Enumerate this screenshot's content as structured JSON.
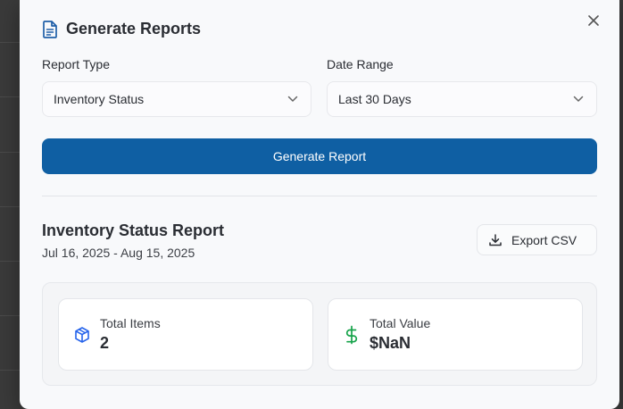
{
  "modal": {
    "title": "Generate Reports",
    "close_icon": "close-icon",
    "title_icon": "document-icon"
  },
  "form": {
    "report_type": {
      "label": "Report Type",
      "value": "Inventory Status"
    },
    "date_range": {
      "label": "Date Range",
      "value": "Last 30 Days"
    },
    "generate_label": "Generate Report"
  },
  "report": {
    "title": "Inventory Status Report",
    "date_range": "Jul 16, 2025 - Aug 15, 2025",
    "export_label": "Export CSV",
    "stats": [
      {
        "label": "Total Items",
        "value": "2",
        "icon": "package-icon",
        "color": "#2563eb"
      },
      {
        "label": "Total Value",
        "value": "$NaN",
        "icon": "dollar-icon",
        "color": "#16a34a"
      }
    ]
  },
  "colors": {
    "primary": "#0f5fa3",
    "background": "#f8f9fb"
  }
}
